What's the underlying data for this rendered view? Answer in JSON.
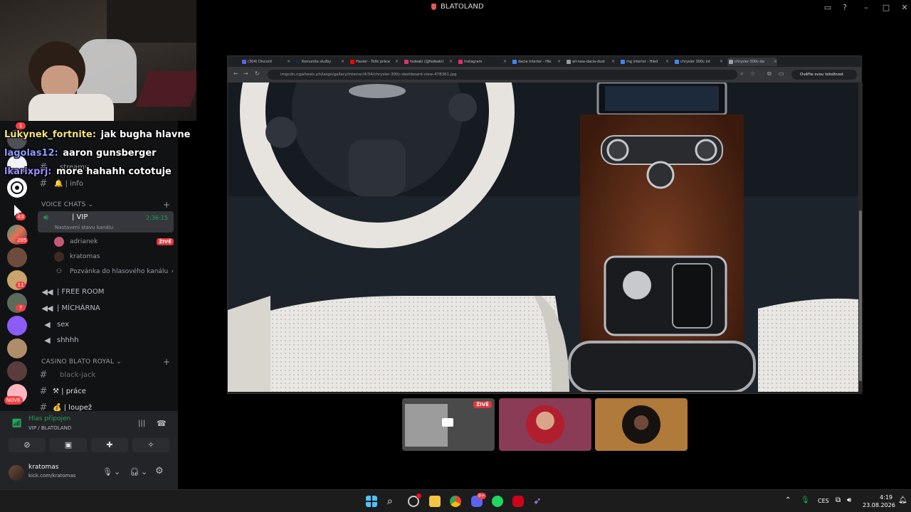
{
  "window": {
    "title": "BLATOLAND"
  },
  "chat": [
    {
      "user": "Lukynek_fortnite:",
      "color": "#f5e27a",
      "message": "jak bugha hlavne"
    },
    {
      "user": "lagolas12:",
      "color": "#8f9bff",
      "message": "aaron gunsberger"
    },
    {
      "user": "lkarixprj:",
      "color": "#9b8cff",
      "message": "more hahahh cototuje"
    }
  ],
  "servers": {
    "badges": [
      "1",
      "43",
      "205",
      "11",
      "7"
    ],
    "new_label": "NOVÉ"
  },
  "channels": {
    "text": [
      {
        "label": "streamy"
      },
      {
        "label": "🔔 | info"
      }
    ],
    "voice_category": "VOICE CHATS",
    "vip": {
      "label": "| VIP",
      "time": "2:36:15",
      "sub": "Nastavení stavu kanálu"
    },
    "vip_users": [
      {
        "name": "adrianek",
        "badge": "ŽIVĚ"
      },
      {
        "name": "kratomas",
        "badge": ""
      }
    ],
    "invite_label": "Pozvánka do hlasového kanálu",
    "voice_rooms": [
      {
        "label": "| FREE ROOM"
      },
      {
        "label": "| MÍCHÁRNA"
      },
      {
        "label": "sex"
      },
      {
        "label": "shhhh"
      }
    ],
    "casino_category": "CASINO BLATO ROYAL",
    "casino": [
      {
        "label": "black-jack"
      },
      {
        "label": "⚒ | práce"
      },
      {
        "label": "💰 | loupež"
      }
    ]
  },
  "voice_panel": {
    "status": "Hlas připojen",
    "location": "VIP / BLATOLAND"
  },
  "user_panel": {
    "name": "kratomas",
    "sub": "kick.com/kratomas"
  },
  "browser": {
    "tabs": [
      {
        "label": "(304) Discord",
        "color": "#5865f2"
      },
      {
        "label": "Komunita služby",
        "color": "#1b2838"
      },
      {
        "label": "Havier - Tolik práce",
        "color": "#ff0000"
      },
      {
        "label": "fadeaki (@fadeaki)",
        "color": "#e1306c"
      },
      {
        "label": "Instagram",
        "color": "#e1306c"
      },
      {
        "label": "dacia interior - Hle",
        "color": "#4285f4"
      },
      {
        "label": "all-new-dacia-dust",
        "color": "#999999"
      },
      {
        "label": "mg interior - Hled",
        "color": "#4285f4"
      },
      {
        "label": "chrysler 300c int",
        "color": "#4285f4"
      },
      {
        "label": "chrysler-300c-da",
        "color": "#9aa0a6"
      }
    ],
    "url": "imgcdn.ngwheels.ph/large/gallery/interior/4/34/chrysler-300c-dashboard-view-478361.jpg",
    "profile_label": "Ověřte svou totožnost"
  },
  "stream_tiles": {
    "live_badge": "ŽIVĚ"
  },
  "taskbar": {
    "lang": "CES",
    "time": "4:19",
    "date": "23.08.2026",
    "discord_badge": "9+"
  }
}
